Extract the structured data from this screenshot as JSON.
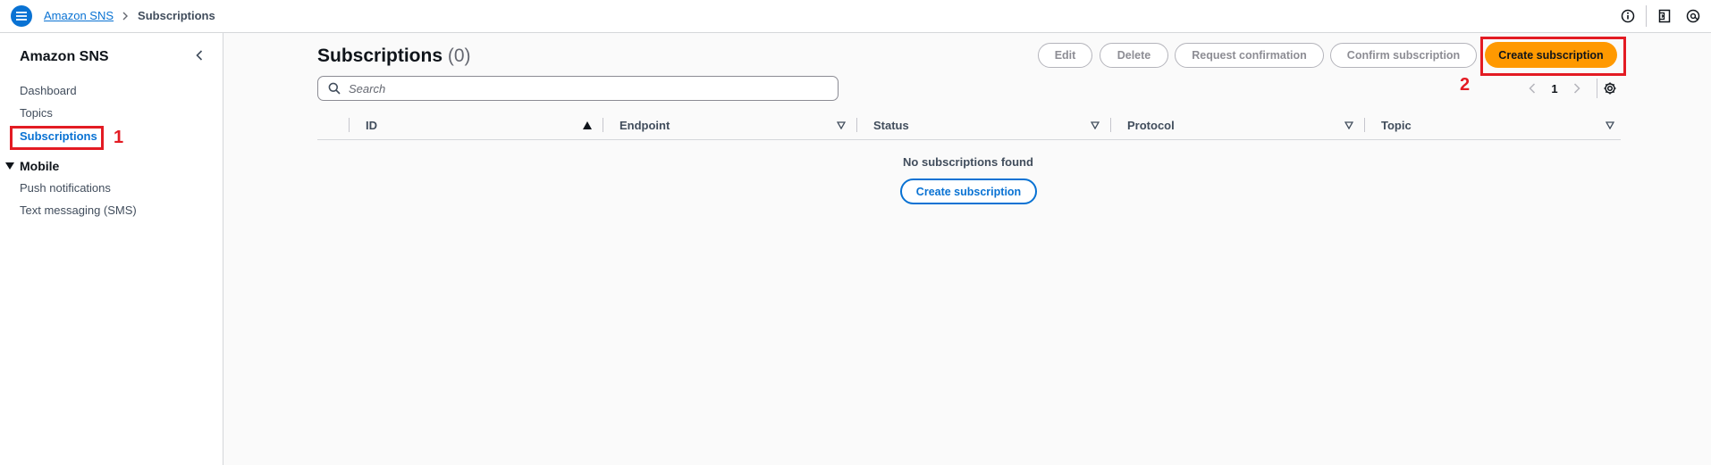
{
  "header": {
    "breadcrumb": {
      "root": "Amazon SNS",
      "current": "Subscriptions"
    },
    "icons": [
      "info-icon",
      "notifications-icon",
      "settings-icon"
    ]
  },
  "sidebar": {
    "title": "Amazon SNS",
    "items": [
      {
        "label": "Dashboard"
      },
      {
        "label": "Topics"
      },
      {
        "label": "Subscriptions",
        "active": true
      }
    ],
    "section": {
      "label": "Mobile",
      "items": [
        {
          "label": "Push notifications"
        },
        {
          "label": "Text messaging (SMS)"
        }
      ]
    }
  },
  "main": {
    "title": "Subscriptions",
    "count": "(0)",
    "buttons": {
      "edit": "Edit",
      "delete": "Delete",
      "request_confirmation": "Request confirmation",
      "confirm_subscription": "Confirm subscription",
      "create_subscription": "Create subscription"
    },
    "search": {
      "placeholder": "Search",
      "value": ""
    },
    "pagination": {
      "page": "1"
    },
    "table": {
      "columns": [
        "ID",
        "Endpoint",
        "Status",
        "Protocol",
        "Topic"
      ],
      "empty_text": "No subscriptions found",
      "empty_button": "Create subscription"
    }
  },
  "annotations": {
    "first": "1",
    "second": "2",
    "color": "#e31b23"
  },
  "colors": {
    "accent": "#0972d3",
    "primary_button": "#ff9900"
  }
}
